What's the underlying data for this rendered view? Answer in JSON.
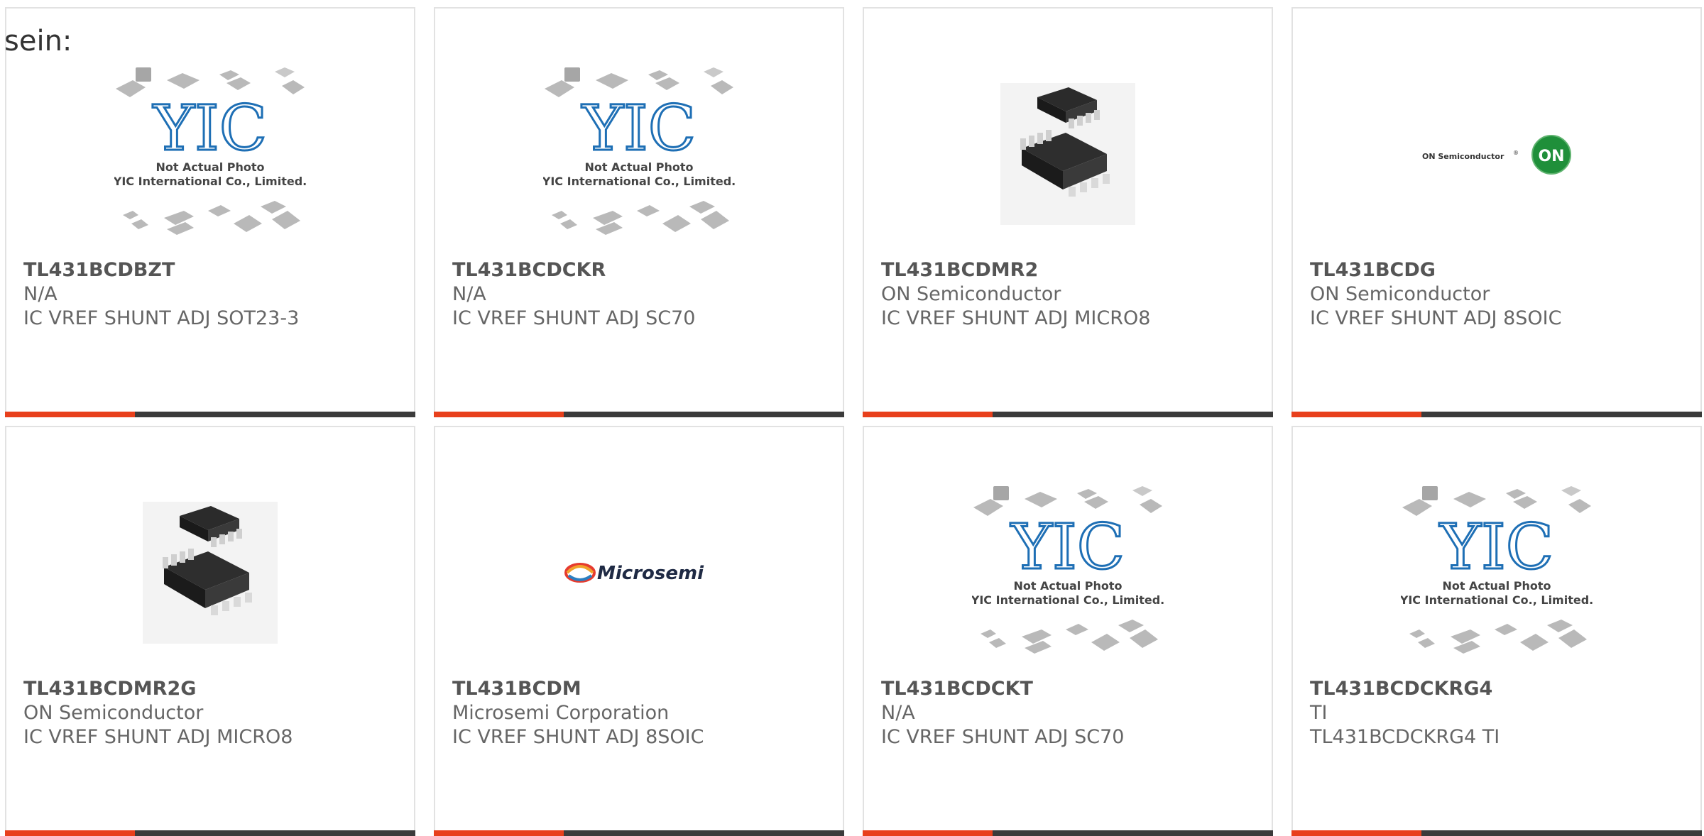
{
  "intro_text": "sein:",
  "placeholder": {
    "line1": "Not Actual Photo",
    "line2": "YIC International Co., Limited.",
    "logo_text": "YIC"
  },
  "brands": {
    "on_semi_text": "ON Semiconductor",
    "on_semi_reg": "®",
    "on_badge": "ON",
    "microsemi_text": "Microsemi"
  },
  "colors": {
    "accent": "#e8401c",
    "bar_dark": "#3b3b3b",
    "on_green": "#1f8f3a",
    "yic_blue": "#1e6fb5"
  },
  "products": [
    {
      "part": "TL431BCDBZT",
      "manufacturer": "N/A",
      "description": "IC VREF SHUNT ADJ SOT23-3",
      "image": "not-actual-photo"
    },
    {
      "part": "TL431BCDCKR",
      "manufacturer": "N/A",
      "description": "IC VREF SHUNT ADJ SC70",
      "image": "not-actual-photo"
    },
    {
      "part": "TL431BCDMR2",
      "manufacturer": "ON Semiconductor",
      "description": "IC VREF SHUNT ADJ MICRO8",
      "image": "micro8-package"
    },
    {
      "part": "TL431BCDG",
      "manufacturer": "ON Semiconductor",
      "description": "IC VREF SHUNT ADJ 8SOIC",
      "image": "on-semiconductor-logo"
    },
    {
      "part": "TL431BCDMR2G",
      "manufacturer": "ON Semiconductor",
      "description": "IC VREF SHUNT ADJ MICRO8",
      "image": "micro8-package"
    },
    {
      "part": "TL431BCDM",
      "manufacturer": "Microsemi Corporation",
      "description": "IC VREF SHUNT ADJ 8SOIC",
      "image": "microsemi-logo"
    },
    {
      "part": "TL431BCDCKT",
      "manufacturer": "N/A",
      "description": "IC VREF SHUNT ADJ SC70",
      "image": "not-actual-photo"
    },
    {
      "part": "TL431BCDCKRG4",
      "manufacturer": "TI",
      "description": "TL431BCDCKRG4 TI",
      "image": "not-actual-photo"
    }
  ]
}
